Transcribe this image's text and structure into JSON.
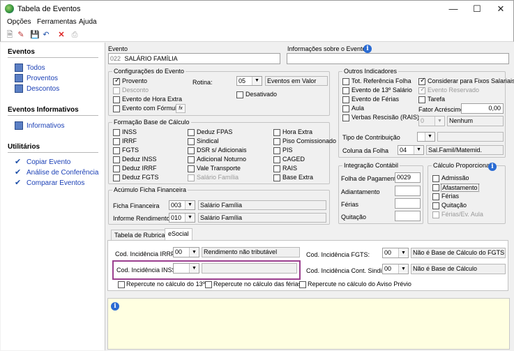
{
  "window": {
    "title": "Tabela de Eventos"
  },
  "menu": {
    "opcoes": "Opções",
    "ferramentas": "Ferramentas",
    "ajuda": "Ajuda"
  },
  "sidebar": {
    "eventos_header": "Eventos",
    "eventos_items": [
      "Todos",
      "Proventos",
      "Descontos"
    ],
    "informativos_header": "Eventos Informativos",
    "informativos_items": [
      "Informativos"
    ],
    "utilitarios_header": "Utilitários",
    "utilitarios_items": [
      "Copiar Evento",
      "Análise de Conferência",
      "Comparar Eventos"
    ]
  },
  "evento": {
    "label": "Evento",
    "code": "022",
    "name": "SALÁRIO FAMÍLIA",
    "info_label": "Informações sobre o Evento"
  },
  "config": {
    "title": "Configurações do Evento",
    "provento": "Provento",
    "desconto": "Desconto",
    "evento_hora_extra": "Evento de Hora Extra",
    "evento_formula": "Evento com Fórmula",
    "rotina_label": "Rotina:",
    "rotina_value": "05",
    "rotina_desc": "Eventos em Valor",
    "desativado": "Desativado",
    "fx": "fx"
  },
  "formacao": {
    "title": "Formação Base de Cálculo",
    "col1": [
      "INSS",
      "IRRF",
      "FGTS",
      "Deduz INSS",
      "Deduz IRRF",
      "Deduz FGTS"
    ],
    "col2": [
      "Deduz FPAS",
      "Sindical",
      "DSR s/ Adicionais",
      "Adicional Noturno",
      "Vale Transporte",
      "Salário Família"
    ],
    "col3": [
      "Hora Extra",
      "Piso Comissionado",
      "PIS",
      "CAGED",
      "RAIS",
      "Base Extra"
    ]
  },
  "acumulo": {
    "title": "Acúmulo Ficha Financeira",
    "ficha_label": "Ficha Financeira",
    "ficha_code": "003",
    "ficha_desc": "Salário Família",
    "informe_label": "Informe Rendimentos",
    "informe_code": "010",
    "informe_desc": "Salário Família"
  },
  "outros": {
    "title": "Outros Indicadores",
    "tot_ref": "Tot. Referência Folha",
    "considerar": "Considerar para Fixos Salariais",
    "evento_13": "Evento de 13º Salário",
    "evento_reservado": "Evento Reservado",
    "evento_ferias": "Evento de Férias",
    "tarefa": "Tarefa",
    "aula": "Aula",
    "fator_label": "Fator Acréscimo",
    "fator_value": "0,00",
    "verbas": "Verbas Rescisão (RAIS)",
    "verbas_code": "0",
    "verbas_desc": "Nenhum",
    "tipo_contrib": "Tipo de Contribuição",
    "coluna_label": "Coluna da Folha",
    "coluna_code": "04",
    "coluna_desc": "Sal.Famil/Matemid."
  },
  "integracao": {
    "title": "Integração Contábil",
    "folha_label": "Folha de Pagamento",
    "folha_value": "0029",
    "adiantamento": "Adiantamento",
    "ferias": "Férias",
    "quitacao": "Quitação"
  },
  "calculo": {
    "title": "Cálculo Proporcional",
    "items": [
      "Admissão",
      "Afastamento",
      "Férias",
      "Quitação",
      "Férias/Ev. Aula"
    ]
  },
  "tabs": [
    "Tabela de Rubricas",
    "eSocial"
  ],
  "esocial": {
    "irrf_label": "Cod. Incidência IRRF:",
    "irrf_code": "00",
    "irrf_desc": "Rendimento não tributável",
    "fgts_label": "Cod. Incidência FGTS:",
    "fgts_code": "00",
    "fgts_desc": "Não é Base de Cálculo do FGTS",
    "inss_label": "Cod. Incidência INSS:",
    "sind_label": "Cod. Incidência Cont. Sindical:",
    "sind_code": "00",
    "sind_desc": "Não é Base de Cálculo",
    "rep13": "Repercute no cálculo do 13º",
    "repferias": "Repercute no cálculo das férias",
    "repaviso": "Repercute no cálculo do Aviso Prévio"
  },
  "colors": {
    "link": "#1a3fb5",
    "highlight": "#9b3f8f",
    "info_bg": "#ffffe1"
  }
}
